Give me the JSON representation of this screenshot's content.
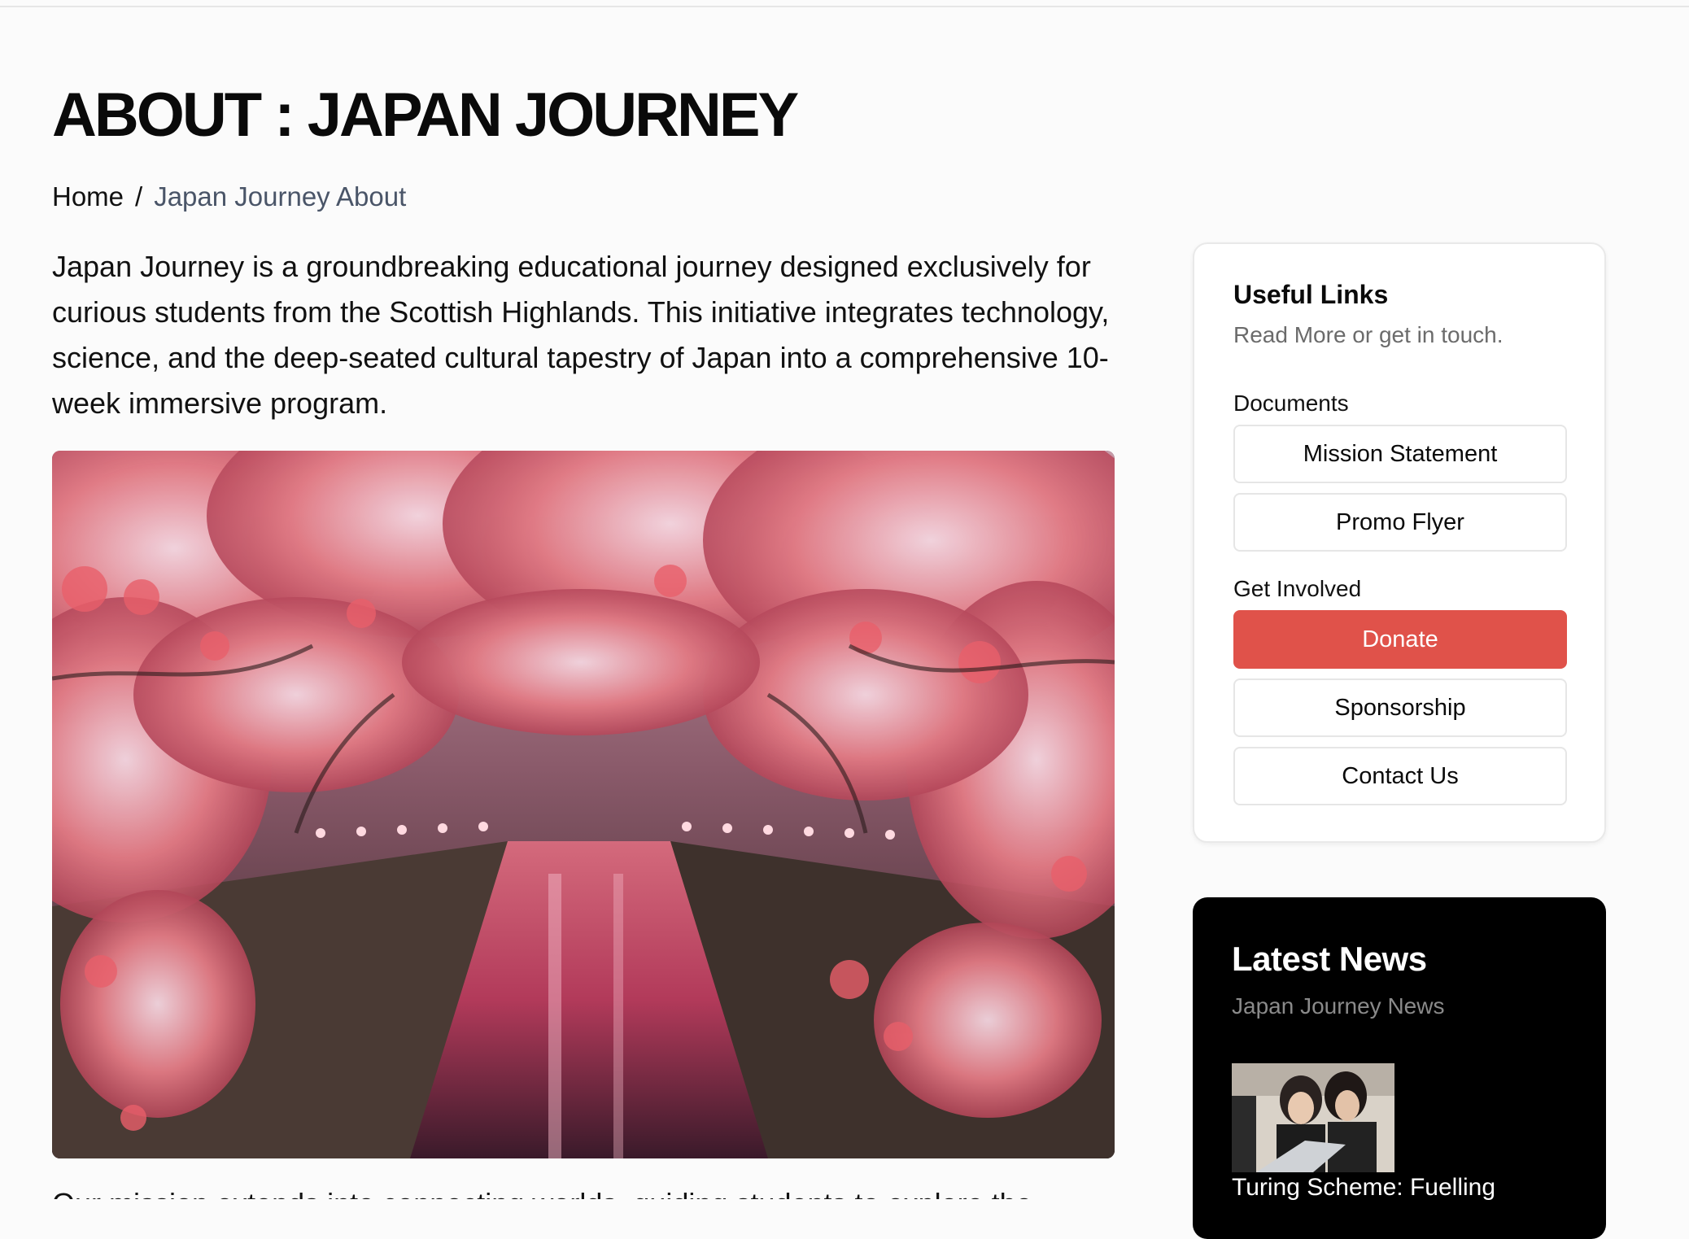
{
  "page": {
    "title": "ABOUT : JAPAN JOURNEY",
    "breadcrumb": {
      "home": "Home",
      "separator": "/",
      "current": "Japan Journey About"
    },
    "intro": "Japan Journey is a groundbreaking educational journey designed exclusively for curious students from the Scottish Highlands. This initiative integrates technology, science, and the deep-seated cultural tapestry of Japan into a comprehensive 10-week immersive program.",
    "hero_image": "cherry-blossom-canal-photo",
    "cut_text": "Our mission extends into connecting worlds, guiding students to explore the"
  },
  "sidebar": {
    "useful_links": {
      "title": "Useful Links",
      "subtitle": "Read More or get in touch.",
      "documents_label": "Documents",
      "documents": [
        "Mission Statement",
        "Promo Flyer"
      ],
      "get_involved_label": "Get Involved",
      "get_involved": [
        "Donate",
        "Sponsorship",
        "Contact Us"
      ]
    },
    "latest_news": {
      "title": "Latest News",
      "subtitle": "Japan Journey News",
      "thumbnail": "students-at-laptop-photo",
      "headline": "Turing Scheme: Fuelling"
    }
  },
  "colors": {
    "accent": "#e0524a",
    "background": "#fbfbfb",
    "news_bg": "#000000",
    "breadcrumb_current": "#4a5568"
  }
}
